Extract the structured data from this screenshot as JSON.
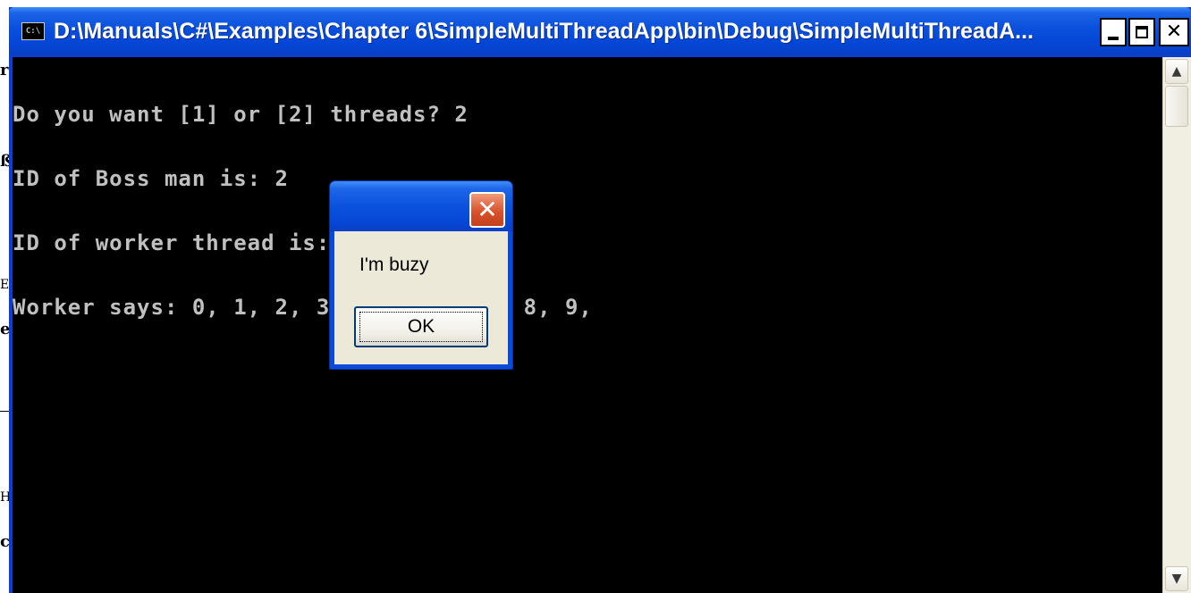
{
  "window": {
    "title": "D:\\Manuals\\C#\\Examples\\Chapter 6\\SimpleMultiThreadApp\\bin\\Debug\\SimpleMultiThreadA...",
    "icon_label": "C:\\"
  },
  "console": {
    "lines": [
      "Do you want [1] or [2] threads? 2",
      "ID of Boss man is: 2",
      "ID of worker thread is: 3",
      "Worker says: 0, 1, 2, 3, 4, 5, 6, 7, 8, 9,"
    ]
  },
  "message_box": {
    "text": "I'm buzy",
    "ok_label": "OK"
  },
  "icons": {
    "app": "console-app-icon",
    "minimize": "minimize-icon",
    "maximize": "maximize-icon",
    "close": "close-icon",
    "scroll_up": "arrow-up-icon",
    "scroll_down": "arrow-down-icon"
  },
  "colors": {
    "titlebar": "#0a4fdc",
    "console_bg": "#000000",
    "console_text": "#c0c0c0",
    "dialog_body": "#ece9d8",
    "close_red": "#d9532c"
  }
}
